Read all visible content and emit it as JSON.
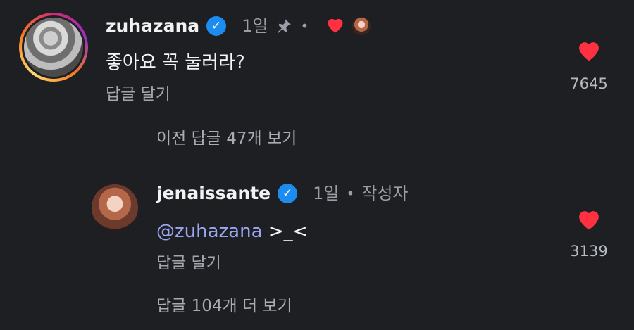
{
  "comment": {
    "username": "zuhazana",
    "time": "1일",
    "text": "좋아요 꼭 눌러라?",
    "reply_label": "답글 달기",
    "likes": "7645"
  },
  "previous_replies": "이전 답글 47개 보기",
  "reply": {
    "username": "jenaissante",
    "time": "1일",
    "author_badge": "작성자",
    "mention": "@zuhazana",
    "text": " >_<",
    "reply_label": "답글 달기",
    "likes": "3139"
  },
  "more_replies": "답글 104개 더 보기",
  "colors": {
    "heart": "#ff3040",
    "verified": "#1d8cf0",
    "mention": "#9aa7f0",
    "background": "#1d1f23"
  }
}
